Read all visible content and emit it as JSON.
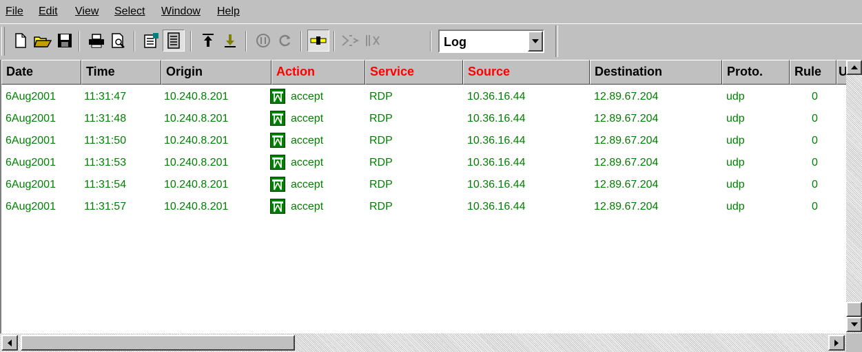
{
  "menu": [
    "File",
    "Edit",
    "View",
    "Select",
    "Window",
    "Help"
  ],
  "toolbar": {
    "log_select_value": "Log"
  },
  "columns": [
    "Date",
    "Time",
    "Origin",
    "Action",
    "Service",
    "Source",
    "Destination",
    "Proto.",
    "Rule",
    "U"
  ],
  "colors": {
    "text_green": "#008000",
    "header_red": "#ff0000"
  },
  "rows": [
    {
      "date": "6Aug2001",
      "time": "11:31:47",
      "origin": "10.240.8.201",
      "action": "accept",
      "service": "RDP",
      "source": "10.36.16.44",
      "destination": "12.89.67.204",
      "proto": "udp",
      "rule": "0"
    },
    {
      "date": "6Aug2001",
      "time": "11:31:48",
      "origin": "10.240.8.201",
      "action": "accept",
      "service": "RDP",
      "source": "10.36.16.44",
      "destination": "12.89.67.204",
      "proto": "udp",
      "rule": "0"
    },
    {
      "date": "6Aug2001",
      "time": "11:31:50",
      "origin": "10.240.8.201",
      "action": "accept",
      "service": "RDP",
      "source": "10.36.16.44",
      "destination": "12.89.67.204",
      "proto": "udp",
      "rule": "0"
    },
    {
      "date": "6Aug2001",
      "time": "11:31:53",
      "origin": "10.240.8.201",
      "action": "accept",
      "service": "RDP",
      "source": "10.36.16.44",
      "destination": "12.89.67.204",
      "proto": "udp",
      "rule": "0"
    },
    {
      "date": "6Aug2001",
      "time": "11:31:54",
      "origin": "10.240.8.201",
      "action": "accept",
      "service": "RDP",
      "source": "10.36.16.44",
      "destination": "12.89.67.204",
      "proto": "udp",
      "rule": "0"
    },
    {
      "date": "6Aug2001",
      "time": "11:31:57",
      "origin": "10.240.8.201",
      "action": "accept",
      "service": "RDP",
      "source": "10.36.16.44",
      "destination": "12.89.67.204",
      "proto": "udp",
      "rule": "0"
    }
  ]
}
